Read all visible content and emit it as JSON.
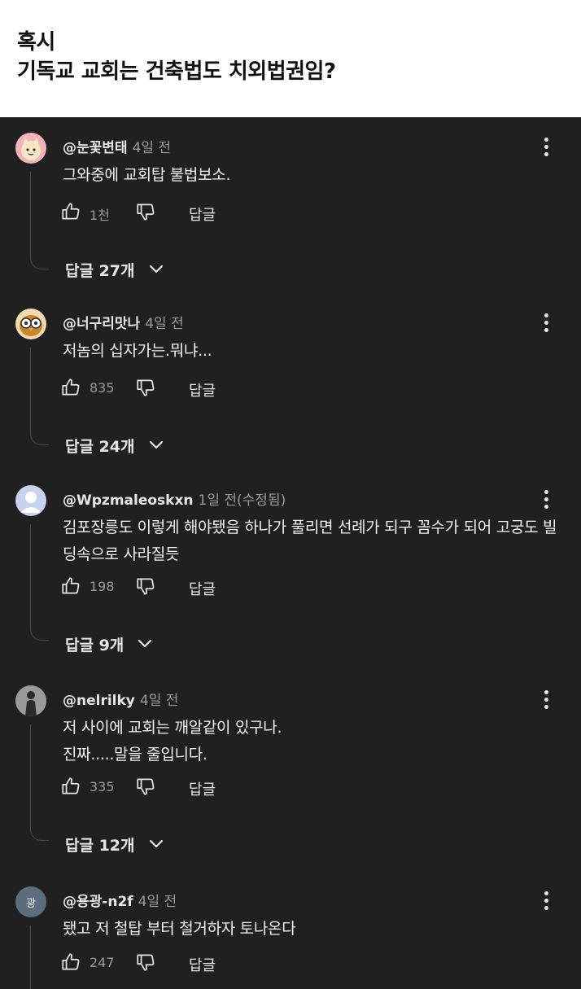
{
  "post": {
    "title": "혹시\n기독교 교회는 건축법도 치외법권임?"
  },
  "comments": [
    {
      "author": "@눈꽃변태",
      "time": "4일 전",
      "text": "그와중에 교회탑 불법보소.",
      "likes": "1천",
      "reply_label": "답글",
      "replies": "답글 27개",
      "avatar": {
        "bg": "#f0b3b8",
        "face": "#f7e6c6",
        "type": "cat"
      }
    },
    {
      "author": "@너구리맛나",
      "time": "4일 전",
      "text": "저놈의 십자가는.뭐냐...",
      "likes": "835",
      "reply_label": "답글",
      "replies": "답글 24개",
      "avatar": {
        "bg": "#f3d9b0",
        "face": "#c8852a",
        "type": "owl"
      }
    },
    {
      "author": "@Wpzmaleoskxn",
      "time": "1일 전(수정됨)",
      "text": "김포장릉도 이렇게 해야됐음 하나가 풀리면 선례가 되구 꼼수가 되어 고궁도 빌딩속으로 사라질듯",
      "likes": "198",
      "reply_label": "답글",
      "replies": "답글 9개",
      "avatar": {
        "bg": "#c7d3ee",
        "face": "#ffffff",
        "type": "default"
      }
    },
    {
      "author": "@nelrilky",
      "time": "4일 전",
      "text": "저 사이에 교회는 깨알같이 있구나.\n진짜.....말을 줄입니다.",
      "likes": "335",
      "reply_label": "답글",
      "replies": "답글 12개",
      "avatar": {
        "bg": "#7a7a7a",
        "face": "#2b2b2b",
        "type": "person"
      }
    },
    {
      "author": "@용광-n2f",
      "time": "4일 전",
      "text": "됐고 저 철탑 부터 철거하자 토나온다",
      "likes": "247",
      "reply_label": "답글",
      "avatar": {
        "bg": "#5b6e7d",
        "face": "#ffffff",
        "type": "letter",
        "letter": "광"
      }
    }
  ],
  "icons": {
    "like": "thumbs-up-icon",
    "dislike": "thumbs-down-icon",
    "more": "vertical-dots-icon",
    "expand": "chevron-down-icon"
  }
}
